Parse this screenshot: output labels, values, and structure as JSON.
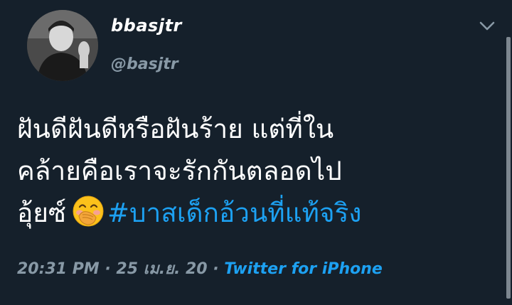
{
  "author": {
    "display_name": "bbasjtr",
    "handle": "@basjtr"
  },
  "tweet": {
    "lines": [
      "ฝันดีฝันดีหรือฝันร้าย แต่ที่ใน",
      "คล้ายคือเราจะรักกันตลอดไป",
      "อุ้ยซ์"
    ],
    "emoji": "face-with-hand-over-mouth",
    "hashtag": "#บาสเด็กอ้วนที่แท้จริง"
  },
  "meta": {
    "time": "20:31 PM",
    "separator": " · ",
    "date": "25 เม.ย. 20",
    "source": "Twitter for iPhone"
  },
  "colors": {
    "background": "#15202b",
    "text": "#ffffff",
    "secondary": "#8899a6",
    "accent": "#1da1f2"
  },
  "icons": {
    "menu": "chevron-down-icon"
  }
}
